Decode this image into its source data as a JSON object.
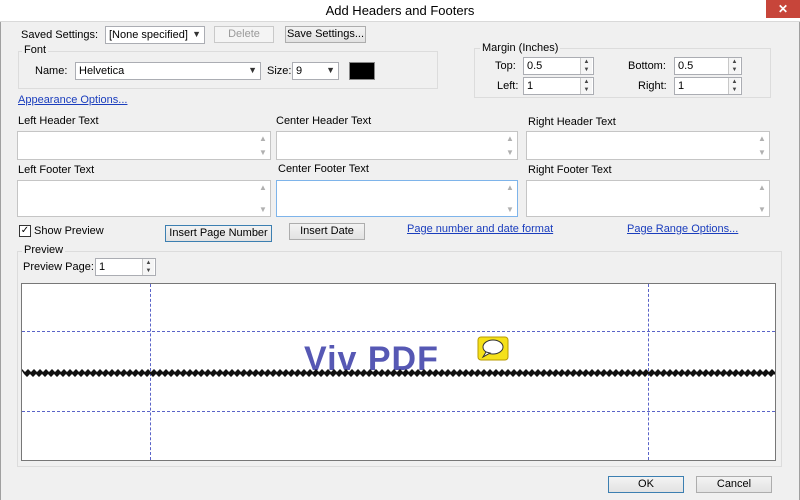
{
  "window": {
    "title": "Add Headers and Footers",
    "close_glyph": "✕"
  },
  "saved_settings": {
    "label": "Saved Settings:",
    "value": "[None specified]",
    "delete_label": "Delete",
    "save_label": "Save Settings..."
  },
  "font": {
    "group_label": "Font",
    "name_label": "Name:",
    "name_value": "Helvetica",
    "size_label": "Size:",
    "size_value": "9",
    "color": "#000000"
  },
  "margin": {
    "group_label": "Margin (Inches)",
    "top_label": "Top:",
    "top_value": "0.5",
    "bottom_label": "Bottom:",
    "bottom_value": "0.5",
    "left_label": "Left:",
    "left_value": "1",
    "right_label": "Right:",
    "right_value": "1"
  },
  "appearance_link": "Appearance Options...",
  "text_fields": {
    "left_header": "Left Header Text",
    "center_header": "Center Header Text",
    "right_header": "Right Header Text",
    "left_footer": "Left Footer Text",
    "center_footer": "Center Footer Text",
    "right_footer": "Right Footer Text"
  },
  "controls": {
    "show_preview_label": "Show Preview",
    "show_preview_checked": true,
    "insert_page_number": "Insert Page Number",
    "insert_date": "Insert Date",
    "page_number_format_link": "Page number and date format",
    "page_range_link": "Page Range Options..."
  },
  "preview": {
    "group_label": "Preview",
    "page_label": "Preview Page:",
    "page_value": "1",
    "watermark_text": "Viv PDF"
  },
  "footer_buttons": {
    "ok": "OK",
    "cancel": "Cancel"
  },
  "colors": {
    "accent_link": "#1a3dbd",
    "guide_lines": "#5a64c8",
    "logo_text": "#5658b4",
    "logo_icon": "#f5e11a"
  }
}
